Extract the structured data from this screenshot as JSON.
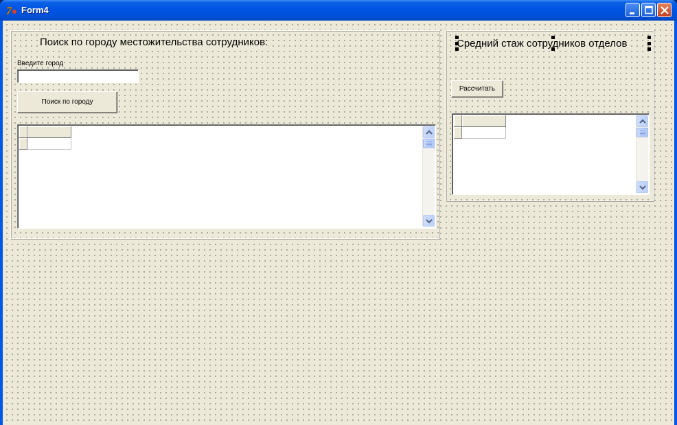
{
  "window": {
    "title": "Form4",
    "app_icon": "delphi-7-icon",
    "controls": [
      "minimize-icon",
      "maximize-icon",
      "close-icon"
    ]
  },
  "city_search": {
    "heading": "Поиск по городу местожительства сотрудников:",
    "city_label": "Введите город",
    "city_input": {
      "value": "",
      "placeholder": ""
    },
    "search_button": "Поиск по городу"
  },
  "experience": {
    "heading": "Средний стаж сотрудников отделов",
    "calc_button": "Рассчитать"
  },
  "colors": {
    "titlebar": "#0054e3",
    "form_bg": "#ece9d8",
    "close_button": "#c8401f"
  }
}
